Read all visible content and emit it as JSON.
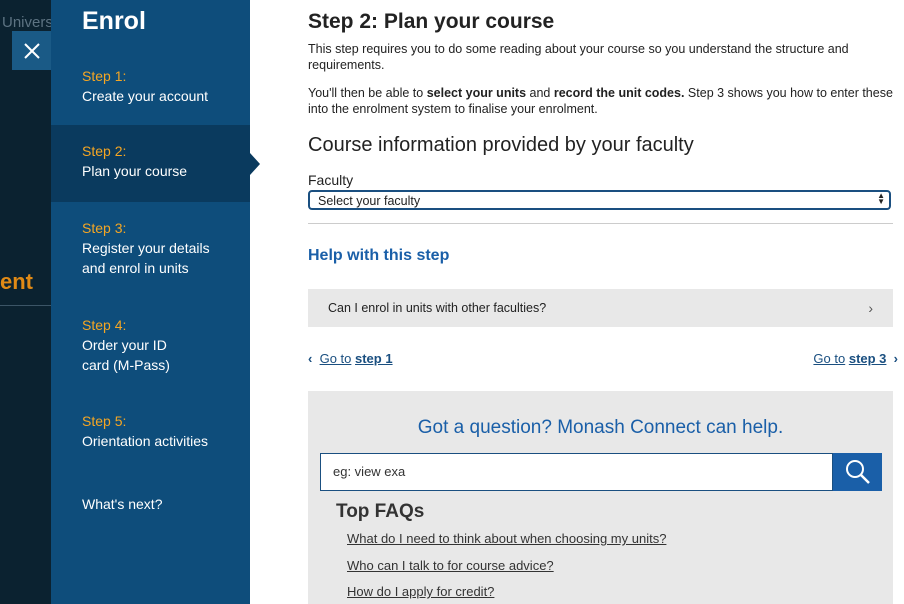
{
  "backdrop": {
    "univ_text": "Univers",
    "ent_text": "ent"
  },
  "sidebar": {
    "title": "Enrol",
    "steps": [
      {
        "num": "Step 1:",
        "label": "Create your account"
      },
      {
        "num": "Step 2:",
        "label": "Plan your course"
      },
      {
        "num": "Step 3:",
        "label": "Register your details and enrol in units"
      },
      {
        "num": "Step 4:",
        "label": "Order your ID card (M-Pass)"
      },
      {
        "num": "Step 5:",
        "label": "Orientation activities"
      }
    ],
    "whats_next": "What's next?"
  },
  "main": {
    "title": "Step 2: Plan your course",
    "intro": "This step requires you to do some reading about your course so you understand the structure and requirements.",
    "para2": {
      "a": "You'll then be able to ",
      "b": "select your units",
      "c": " and ",
      "d": "record the unit codes.",
      "e": " Step 3 shows you how to enter these into the enrolment system to finalise your enrolment."
    },
    "course_heading": "Course information provided by your faculty",
    "faculty_label": "Faculty",
    "faculty_select_value": "Select your faculty",
    "help_heading": "Help with this step",
    "accordion_item": "Can I enrol in units with other faculties?",
    "prev": {
      "go_to": "Go to",
      "step": "step 1"
    },
    "next": {
      "go_to": "Go to",
      "step": "step 3"
    }
  },
  "help_box": {
    "heading": "Got a question? Monash Connect can help.",
    "search_value": "eg: view exa",
    "faq_title": "Top FAQs",
    "faqs": [
      "What do I need to think about when choosing my units?",
      "Who can I talk to for course advice?",
      "How do I apply for credit?"
    ]
  },
  "colors": {
    "sidebar": "#0e4d7b",
    "sidebar_active": "#0a3a5e",
    "step_accent": "#f5a623",
    "link": "#1a5fa8"
  }
}
